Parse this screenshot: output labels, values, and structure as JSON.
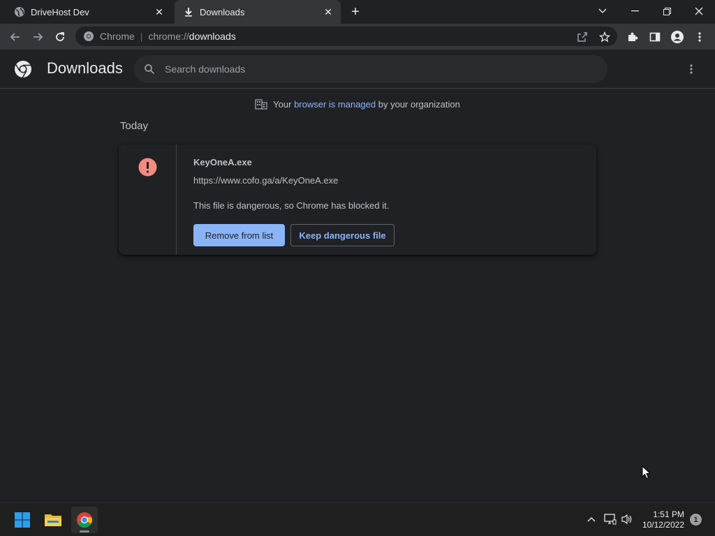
{
  "tabs": [
    {
      "title": "DriveHost Dev",
      "icon": "globe-icon",
      "active": false
    },
    {
      "title": "Downloads",
      "icon": "download-icon",
      "active": true
    }
  ],
  "toolbar": {
    "omnibox_chip": "Chrome",
    "omnibox_scheme": "chrome://",
    "omnibox_host": "downloads"
  },
  "downloads": {
    "title": "Downloads",
    "search_placeholder": "Search downloads",
    "managed": {
      "prefix": "Your ",
      "link": "browser is managed",
      "suffix": " by your organization"
    },
    "date_header": "Today",
    "item": {
      "file_name": "KeyOneA.exe",
      "url": "https://www.cofo.ga/a/KeyOneA.exe",
      "description": "This file is dangerous, so Chrome has blocked it.",
      "remove_label": "Remove from list",
      "keep_label": "Keep dangerous file",
      "warning_color": "#f28b82"
    }
  },
  "taskbar": {
    "time": "1:51 PM",
    "date": "10/12/2022",
    "notification_count": "1"
  },
  "colors": {
    "accent": "#8ab4f8",
    "background": "#202124",
    "toolbar": "#35363a"
  }
}
